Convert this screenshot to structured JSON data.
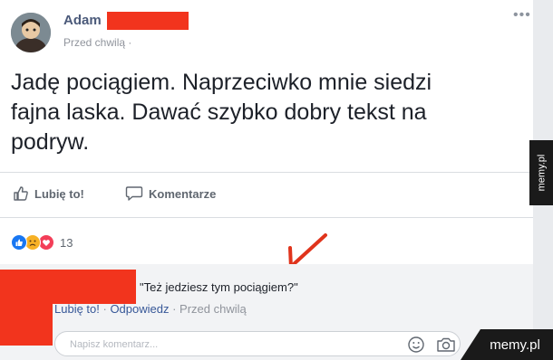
{
  "post": {
    "author": "Adam",
    "time": "Przed chwilą ·",
    "more": "•••",
    "text_lines": [
      "Jadę pociągiem. Naprzeciwko mnie siedzi",
      "fajna laska. Dawać szybko dobry tekst na",
      "podryw."
    ]
  },
  "actions": {
    "like": "Lubię to!",
    "comment": "Komentarze"
  },
  "reactions": {
    "count": "13",
    "icons": [
      "like-icon",
      "sad-icon",
      "love-icon"
    ]
  },
  "comment": {
    "text": "\"Też jedziesz tym pociągiem?\"",
    "like": "Lubię to!",
    "sep1": " · ",
    "reply": "Odpowiedz",
    "sep2": " · ",
    "time": "Przed chwilą"
  },
  "composer": {
    "placeholder": "Napisz komentarz..."
  },
  "watermark": {
    "side": "memy.pl",
    "corner": "memy.pl"
  },
  "colors": {
    "redaction": "#f2341d",
    "arrow": "#e0341c",
    "link": "#385898",
    "like_blue": "#1877f2",
    "love_red": "#f33e58",
    "sad_yellow": "#f7b125"
  }
}
